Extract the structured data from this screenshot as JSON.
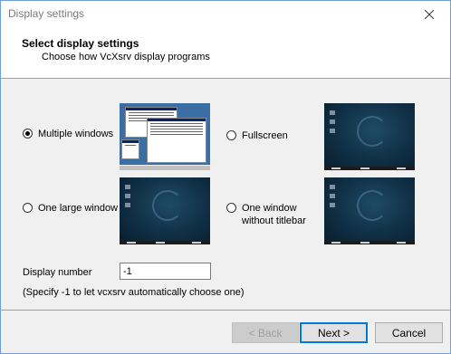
{
  "window": {
    "title": "Display settings",
    "close_icon": "close-icon"
  },
  "header": {
    "title": "Select display settings",
    "subtitle": "Choose how VcXsrv display programs"
  },
  "options": [
    {
      "label": "Multiple windows",
      "checked": true
    },
    {
      "label": "Fullscreen",
      "checked": false
    },
    {
      "label": "One large window",
      "checked": false
    },
    {
      "label_line1": "One window",
      "label_line2": "without titlebar",
      "checked": false
    }
  ],
  "display_number": {
    "label": "Display number",
    "value": "-1",
    "hint": "(Specify -1 to let vcxsrv automatically choose one)"
  },
  "buttons": {
    "back": "< Back",
    "next": "Next >",
    "cancel": "Cancel"
  }
}
